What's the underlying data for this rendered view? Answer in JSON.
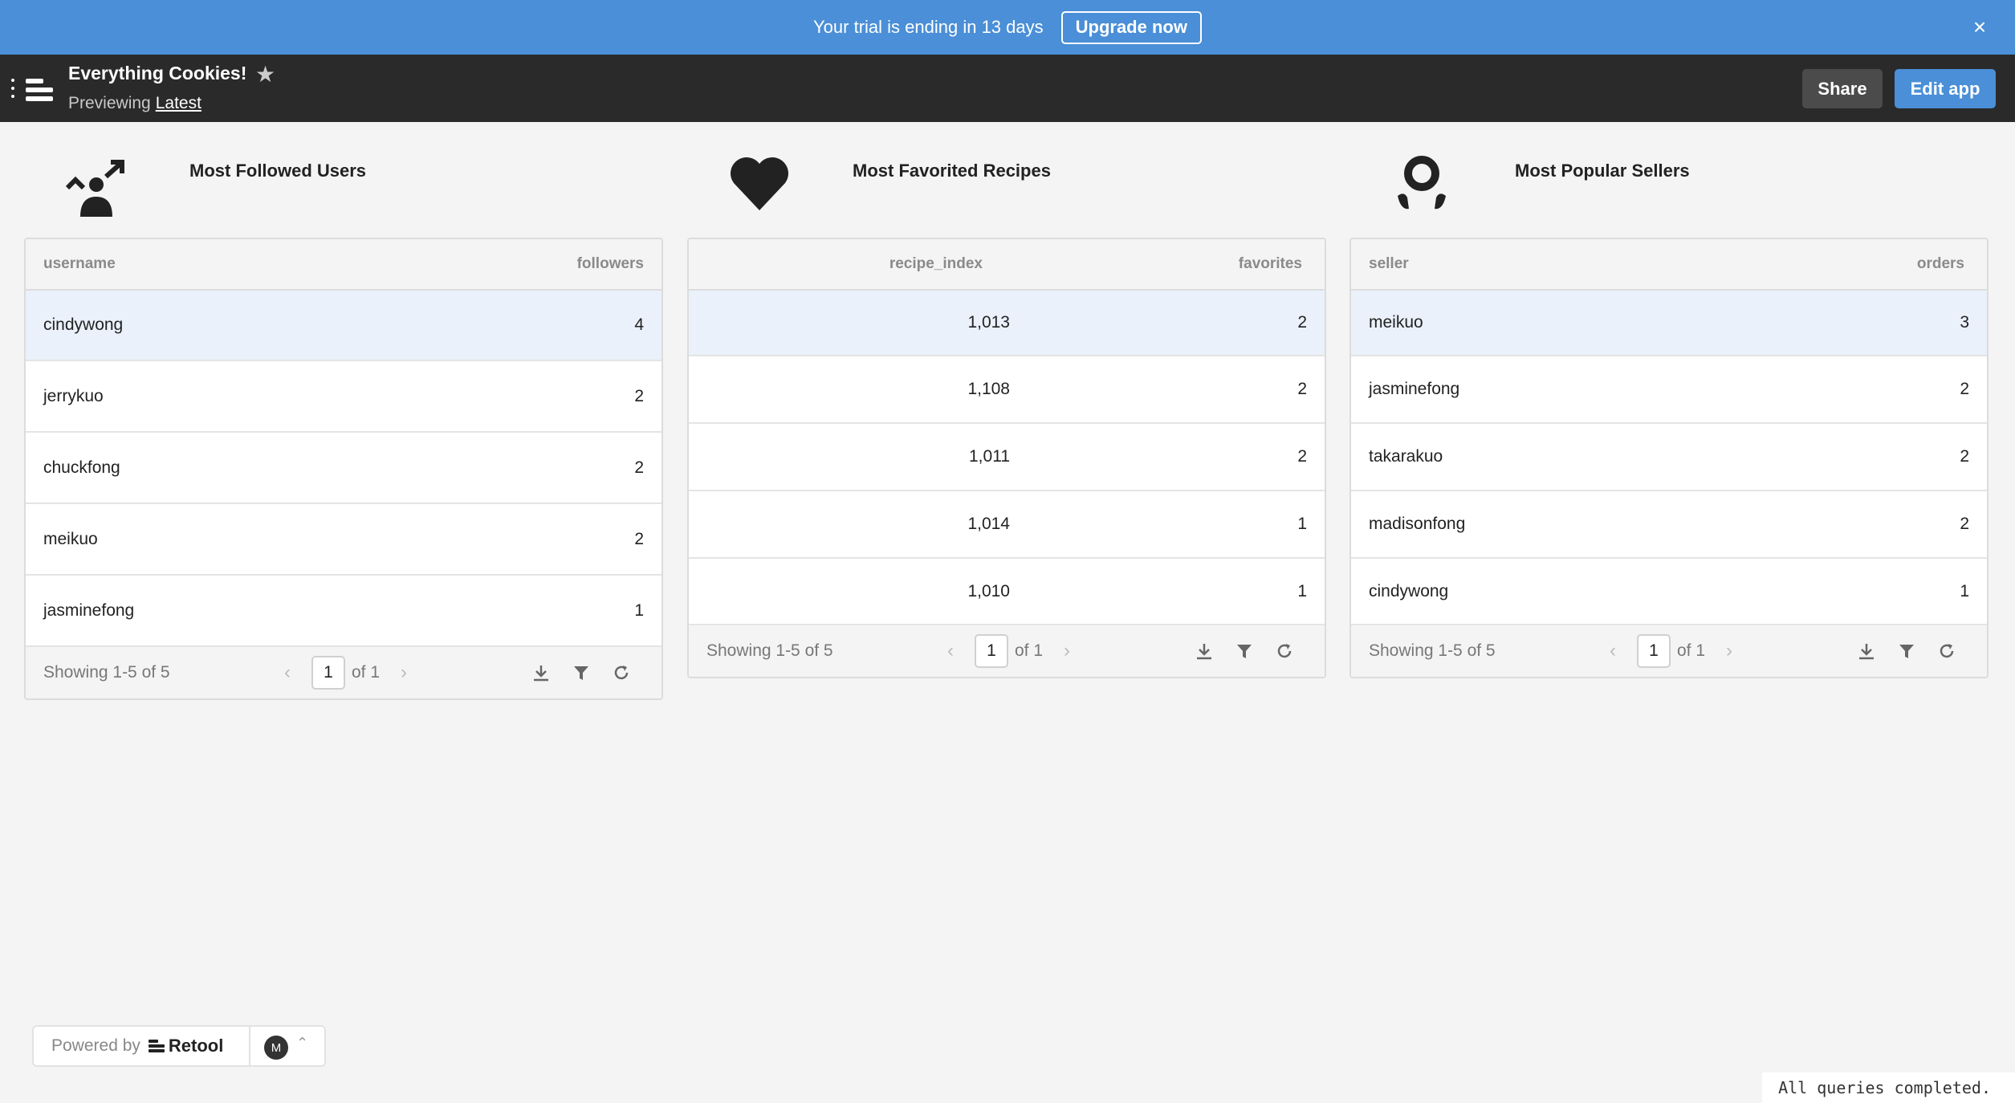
{
  "banner": {
    "text": "Your trial is ending in 13 days",
    "upgrade_label": "Upgrade now",
    "close_icon": "×"
  },
  "header": {
    "title": "Everything Cookies!",
    "previewing": "Previewing",
    "version": "Latest",
    "share_label": "Share",
    "edit_label": "Edit app"
  },
  "widgets": [
    {
      "title": "Most Followed Users",
      "icon": "user-arrow-icon",
      "columns": [
        "username",
        "followers"
      ],
      "rows": [
        [
          "cindywong",
          "4"
        ],
        [
          "jerrykuo",
          "2"
        ],
        [
          "chuckfong",
          "2"
        ],
        [
          "meikuo",
          "2"
        ],
        [
          "jasminefong",
          "1"
        ]
      ],
      "footer": {
        "showing": "Showing 1-5 of 5",
        "page": "1",
        "of": "of 1"
      }
    },
    {
      "title": "Most Favorited Recipes",
      "icon": "heart-icon",
      "columns": [
        "recipe_index",
        "favorites"
      ],
      "rows": [
        [
          "1,013",
          "2"
        ],
        [
          "1,108",
          "2"
        ],
        [
          "1,011",
          "2"
        ],
        [
          "1,014",
          "1"
        ],
        [
          "1,010",
          "1"
        ]
      ],
      "footer": {
        "showing": "Showing 1-5 of 5",
        "page": "1",
        "of": "of 1"
      }
    },
    {
      "title": "Most Popular Sellers",
      "icon": "award-icon",
      "columns": [
        "seller",
        "orders"
      ],
      "rows": [
        [
          "meikuo",
          "3"
        ],
        [
          "jasminefong",
          "2"
        ],
        [
          "takarakuo",
          "2"
        ],
        [
          "madisonfong",
          "2"
        ],
        [
          "cindywong",
          "1"
        ]
      ],
      "footer": {
        "showing": "Showing 1-5 of 5",
        "page": "1",
        "of": "of 1"
      }
    }
  ],
  "bottom": {
    "powered_by": "Powered by",
    "brand": "Retool",
    "avatar_initial": "M",
    "status": "All queries completed."
  },
  "colors": {
    "banner": "#4a8fd7",
    "header": "#2a2a2a",
    "edit_button": "#4a8fd7",
    "selected_row": "#eaf1fa"
  }
}
